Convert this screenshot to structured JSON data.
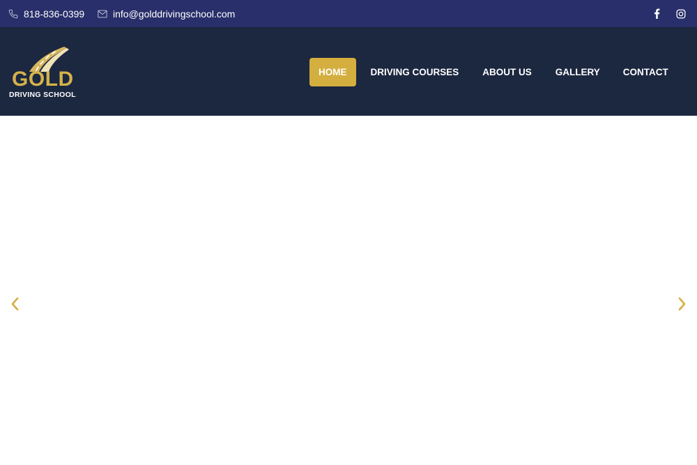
{
  "topbar": {
    "phone": "818-836-0399",
    "email": "info@golddrivingschool.com",
    "phone_icon": "phone-icon",
    "email_icon": "envelope-icon",
    "social": [
      {
        "icon": "facebook-icon"
      },
      {
        "icon": "instagram-icon"
      }
    ],
    "background": "#282f6a"
  },
  "header": {
    "background": "#1c2740",
    "logo": {
      "word": "GOLD",
      "subtitle": "DRIVING SCHOOL",
      "color": "#d4b24a"
    },
    "nav": [
      {
        "label": "HOME",
        "active": true
      },
      {
        "label": "DRIVING COURSES",
        "active": false
      },
      {
        "label": "ABOUT US",
        "active": false
      },
      {
        "label": "GALLERY",
        "active": false
      },
      {
        "label": "CONTACT",
        "active": false
      }
    ],
    "accent": "#d4ae3e"
  },
  "slider": {
    "prev_icon": "chevron-left-icon",
    "next_icon": "chevron-right-icon",
    "arrow_color": "#d4ae3e"
  }
}
